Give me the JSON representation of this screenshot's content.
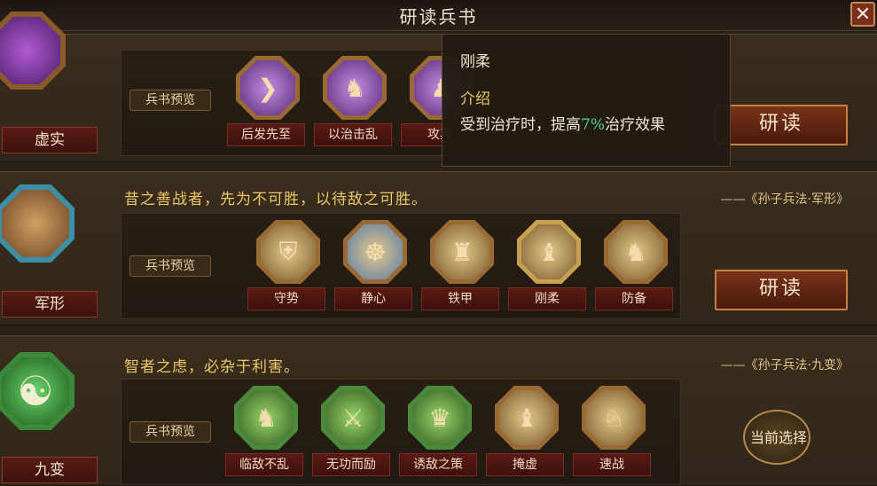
{
  "window": {
    "title": "研读兵书",
    "close_icon": "close-icon"
  },
  "sections": [
    {
      "name": "虚实",
      "quote": "",
      "source": "",
      "preview_label": "兵书预览",
      "skills": [
        "后发先至",
        "以治击乱",
        "攻其"
      ],
      "action": "研读",
      "emblem_color": "#8b3fae"
    },
    {
      "name": "军形",
      "quote": "昔之善战者，先为不可胜，以待敌之可胜。",
      "source": "——《孙子兵法·军形》",
      "preview_label": "兵书预览",
      "skills": [
        "守势",
        "静心",
        "铁甲",
        "刚柔",
        "防备"
      ],
      "action": "研读",
      "emblem_color": "#3aa7c7"
    },
    {
      "name": "九变",
      "quote": "智者之虑，必杂于利害。",
      "source": "——《孙子兵法·九变》",
      "preview_label": "兵书预览",
      "skills": [
        "临敌不乱",
        "无功而励",
        "诱敌之策",
        "掩虚",
        "速战"
      ],
      "action": "当前选择",
      "emblem_color": "#3f9a43"
    }
  ],
  "tooltip": {
    "title": "刚柔",
    "section_label": "介绍",
    "desc_before": "受到治疗时，提高",
    "desc_pct": "7%",
    "desc_after": "治疗效果"
  }
}
